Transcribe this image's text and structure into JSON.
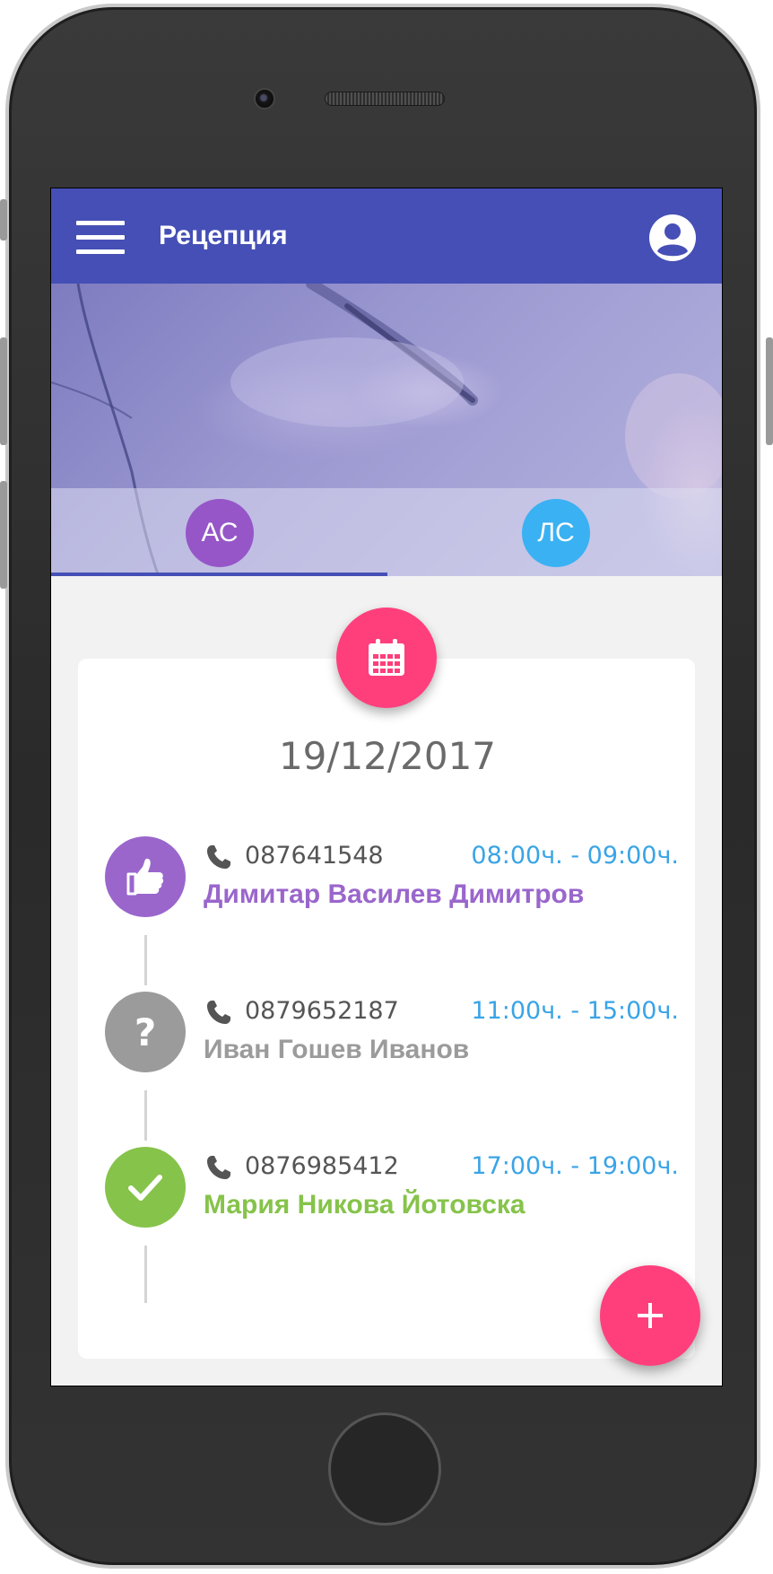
{
  "app": {
    "title": "Рецепция",
    "accent_color": "#454fb6",
    "fab_color": "#ff3f7c"
  },
  "header": {
    "menu_icon": "menu-icon",
    "account_icon": "account-circle-icon"
  },
  "tabs": [
    {
      "label": "АС",
      "color": "#9656c8",
      "selected": true
    },
    {
      "label": "ЛС",
      "color": "#3ab1f2",
      "selected": false
    }
  ],
  "schedule": {
    "calendar_icon": "calendar-icon",
    "date": "19/12/2017",
    "entries": [
      {
        "status": "confirmed",
        "status_icon": "thumbs-up-icon",
        "status_color": "#9a66cc",
        "phone": "087641548",
        "time": "08:00ч. - 09:00ч.",
        "name": "Димитар Василев Димитров",
        "name_color": "#9a66cc"
      },
      {
        "status": "unknown",
        "status_icon": "question-icon",
        "status_color": "#9b9b9b",
        "phone": "0879652187",
        "time": "11:00ч. - 15:00ч.",
        "name": "Иван Гошев Иванов",
        "name_color": "#9b9b9b"
      },
      {
        "status": "done",
        "status_icon": "check-icon",
        "status_color": "#86c34a",
        "phone": "0876985412",
        "time": "17:00ч. - 19:00ч.",
        "name": "Мария Никова Йотовска",
        "name_color": "#86c34a"
      }
    ]
  },
  "fab": {
    "label": "+",
    "icon": "plus-icon"
  }
}
